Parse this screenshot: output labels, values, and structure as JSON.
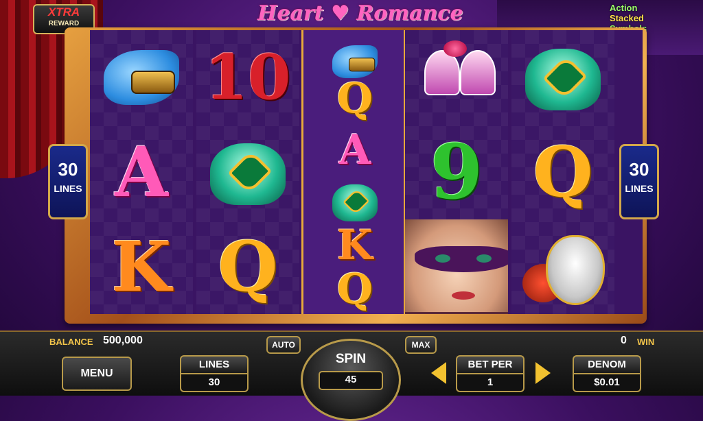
{
  "logos": {
    "xtra_top": "XTRA",
    "xtra_bottom": "REWARD",
    "title": "Heart ♥ Romance",
    "action_l1": "Action",
    "action_l2": "Stacked",
    "action_l3": "Symbols"
  },
  "reels": [
    [
      "gloves-binoculars",
      "A",
      "K"
    ],
    [
      "10",
      "emerald-pouch",
      "Q"
    ],
    [
      "Q",
      "A",
      "K"
    ],
    [
      "champagne-glasses",
      "9",
      "masked-lady"
    ],
    [
      "emerald-pouch",
      "Q",
      "venetian-mask"
    ]
  ],
  "reel3_stack": {
    "top_small": "gloves-binoculars",
    "mid_small": "emerald-pouch",
    "bottom_second": "Q"
  },
  "lines_badge": {
    "number": "30",
    "label": "LINES"
  },
  "panel": {
    "balance_label": "BALANCE",
    "balance_value": "500,000",
    "win_value": "0",
    "win_label": "WIN",
    "menu": "MENU",
    "auto": "AUTO",
    "max": "MAX",
    "lines_label": "LINES",
    "lines_value": "30",
    "spin_label": "SPIN",
    "spin_value": "45",
    "bet_per_label": "BET PER",
    "bet_per_value": "1",
    "denom_label": "DENOM",
    "denom_value": "$0.01"
  },
  "colors": {
    "accent_gold": "#f2c44a",
    "frame_gold": "#e6a040",
    "reel_bg": "#3b1766"
  }
}
